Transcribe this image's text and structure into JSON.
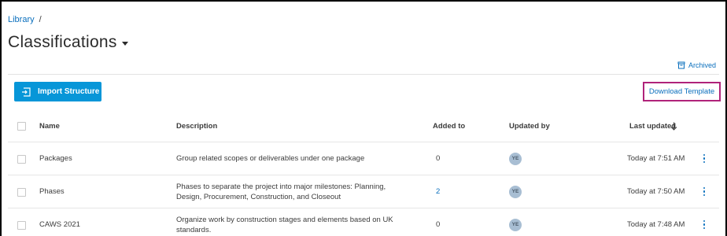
{
  "breadcrumb": {
    "root": "Library",
    "separator": "/"
  },
  "page": {
    "title": "Classifications"
  },
  "archived_label": "Archived",
  "toolbar": {
    "import_label": "Import Structure",
    "download_label": "Download Template"
  },
  "table": {
    "columns": {
      "name": "Name",
      "description": "Description",
      "added_to": "Added to",
      "updated_by": "Updated by",
      "last_updated": "Last updated"
    },
    "rows": [
      {
        "name": "Packages",
        "description": "Group related scopes or deliverables under one package",
        "added_to": "0",
        "updated_by": "YE",
        "last_updated": "Today at 7:51 AM"
      },
      {
        "name": "Phases",
        "description": "Phases to separate the project into major milestones: Planning, Design, Procurement, Construction, and Closeout",
        "added_to": "2",
        "updated_by": "YE",
        "last_updated": "Today at 7:50 AM"
      },
      {
        "name": "CAWS 2021",
        "description": "Organize work by construction stages and elements based on UK standards.",
        "added_to": "0",
        "updated_by": "YE",
        "last_updated": "Today at 7:48 AM"
      }
    ]
  },
  "colors": {
    "accent": "#0796d8",
    "link": "#0a6fbd",
    "highlight": "#b0237a",
    "avatar": "#a8bed3"
  },
  "icons": {
    "import": "import-structure-icon",
    "archive": "archive-box-icon",
    "sort": "arrow-down-icon",
    "more": "kebab-menu-icon"
  }
}
